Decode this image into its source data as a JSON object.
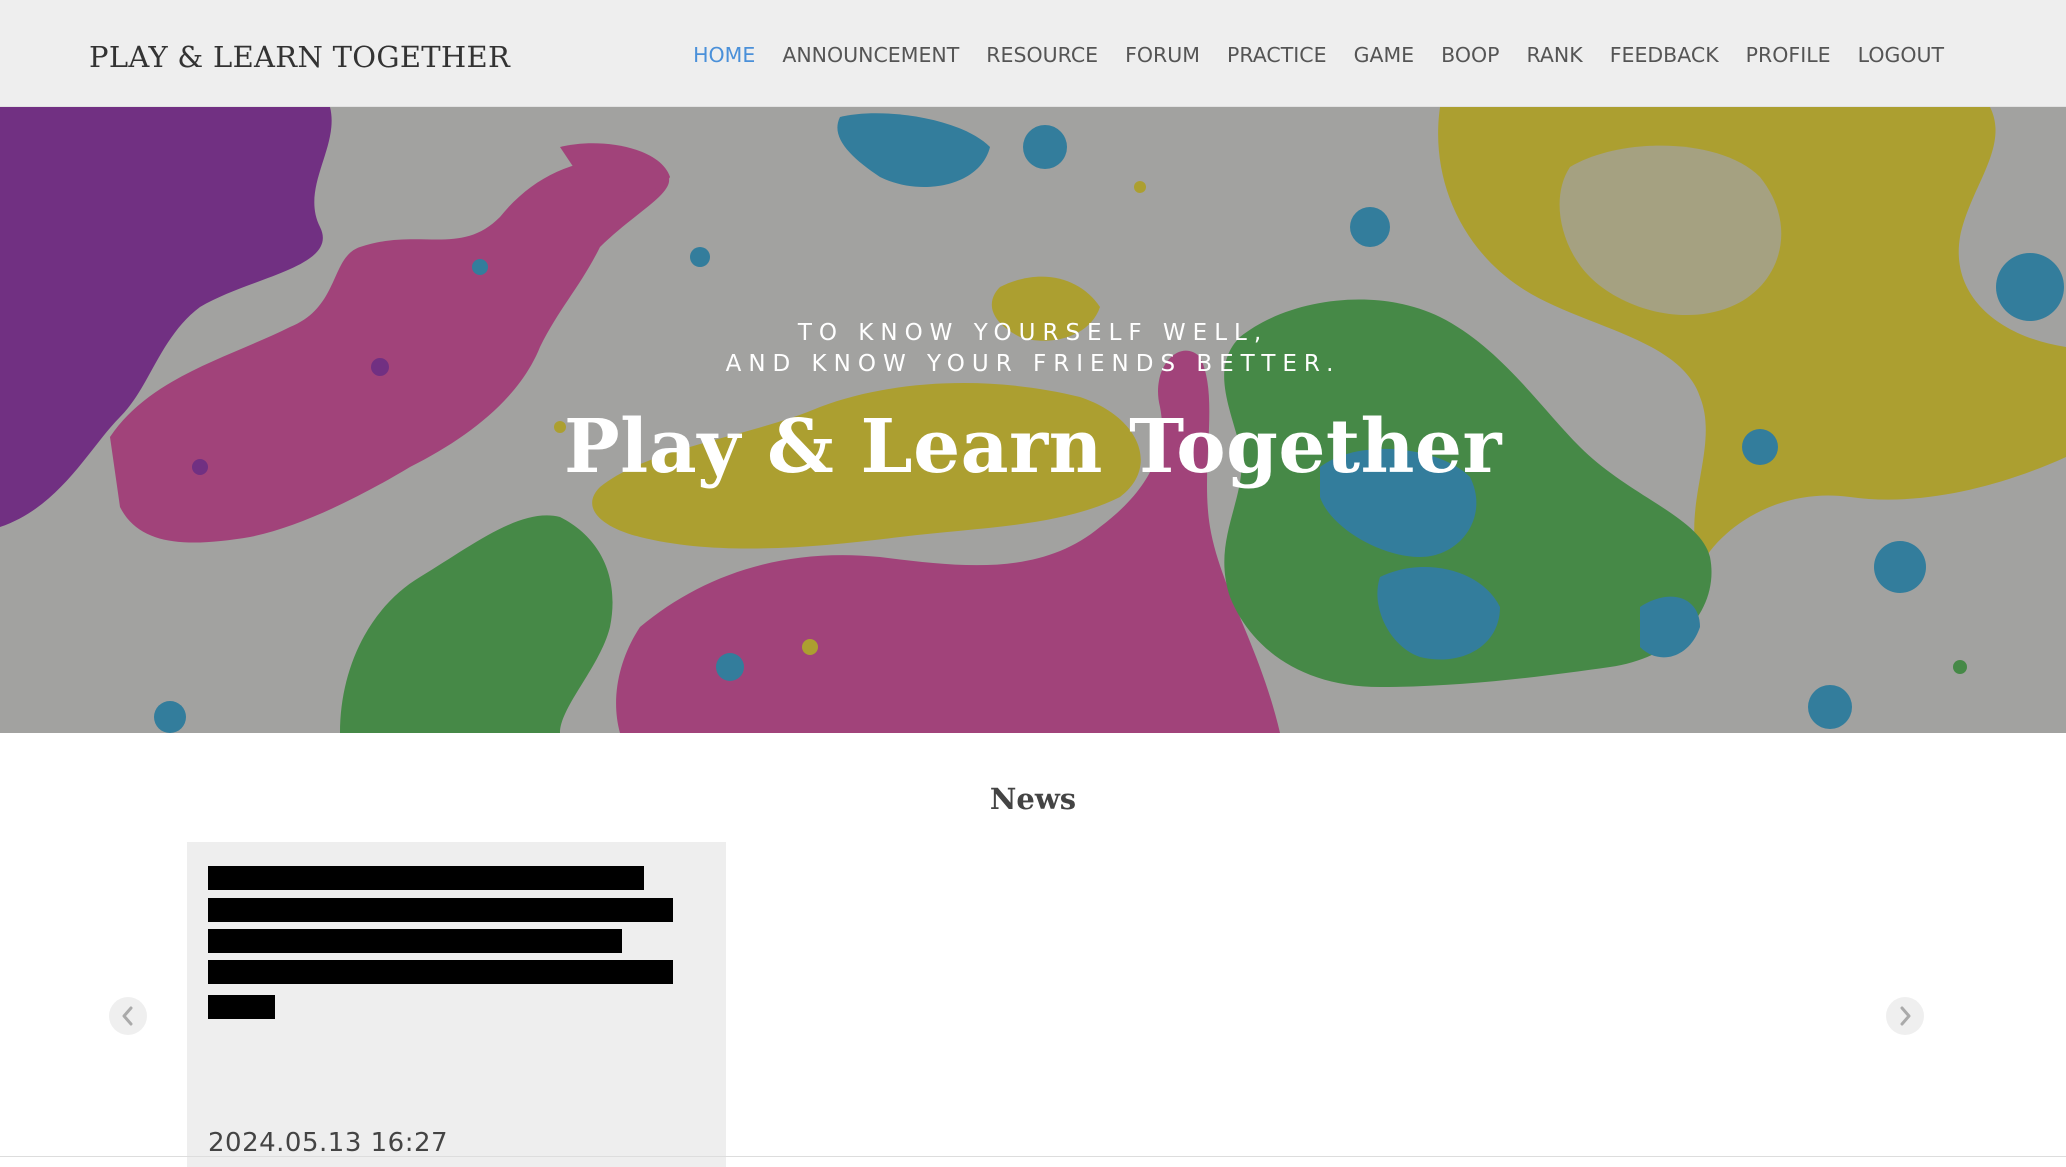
{
  "navbar": {
    "brand": "PLAY & LEARN TOGETHER",
    "items": [
      {
        "label": "HOME",
        "active": true
      },
      {
        "label": "ANNOUNCEMENT",
        "active": false
      },
      {
        "label": "RESOURCE",
        "active": false
      },
      {
        "label": "FORUM",
        "active": false
      },
      {
        "label": "PRACTICE",
        "active": false
      },
      {
        "label": "GAME",
        "active": false
      },
      {
        "label": "BOOP",
        "active": false
      },
      {
        "label": "RANK",
        "active": false
      },
      {
        "label": "FEEDBACK",
        "active": false
      },
      {
        "label": "PROFILE",
        "active": false
      },
      {
        "label": "LOGOUT",
        "active": false
      }
    ]
  },
  "hero": {
    "tagline_line1": "TO KNOW YOURSELF WELL,",
    "tagline_line2": "AND KNOW YOUR FRIENDS BETTER.",
    "title": "Play & Learn Together"
  },
  "news": {
    "heading": "News",
    "cards": [
      {
        "date": "2024.05.13 16:27"
      }
    ],
    "prev_icon": "chevron-left-icon",
    "next_icon": "chevron-right-icon"
  },
  "colors": {
    "nav_background": "#eeeeee",
    "nav_active": "#4a90d9",
    "nav_text": "#555555",
    "card_background": "#eeeeee"
  }
}
